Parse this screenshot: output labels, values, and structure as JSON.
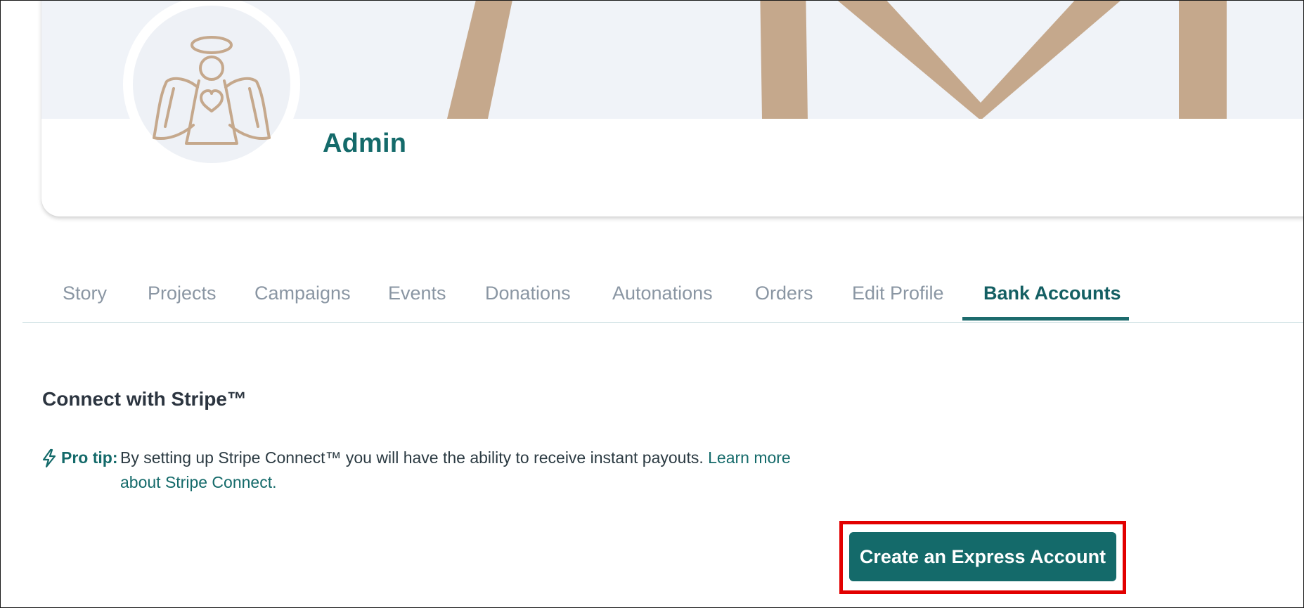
{
  "profile": {
    "name": "Admin",
    "avatar_icon": "angel-heart-icon"
  },
  "tabs": [
    {
      "label": "Story",
      "active": false
    },
    {
      "label": "Projects",
      "active": false
    },
    {
      "label": "Campaigns",
      "active": false
    },
    {
      "label": "Events",
      "active": false
    },
    {
      "label": "Donations",
      "active": false
    },
    {
      "label": "Autonations",
      "active": false
    },
    {
      "label": "Orders",
      "active": false
    },
    {
      "label": "Edit Profile",
      "active": false
    },
    {
      "label": "Bank Accounts",
      "active": true
    }
  ],
  "stripe": {
    "title": "Connect with Stripe™",
    "tip_icon": "lightning-bolt-icon",
    "tip_label": "Pro tip:",
    "tip_text": "By setting up Stripe Connect™ you will have the ability to receive instant payouts.",
    "tip_link_line1": "Learn more",
    "tip_link_line2": "about Stripe Connect.",
    "button_label": "Create an Express Account"
  },
  "colors": {
    "brand_teal": "#146a6a",
    "cover_accent": "#c5a88c",
    "cover_background": "#f0f3f8",
    "highlight_red": "#e20000",
    "inactive_tab": "#8a96a3"
  }
}
